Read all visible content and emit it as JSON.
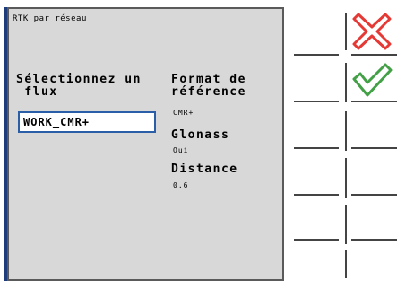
{
  "panel": {
    "title": "RTK par réseau",
    "select_label": "Sélectionnez un\n flux",
    "flux_value": "WORK_CMR+",
    "format_label": "Format de\nréférence",
    "format_value": "CMR+",
    "glonass_label": "Glonass",
    "glonass_value": "Oui",
    "distance_label": "Distance",
    "distance_value": "0.6"
  },
  "softkeys": {
    "cancel_icon": "red-x-cancel",
    "confirm_icon": "green-checkmark-confirm"
  },
  "colors": {
    "panel_bg": "#d8d8d8",
    "input_border": "#2a5fa8",
    "cancel": "#e53935",
    "confirm": "#43a047"
  }
}
